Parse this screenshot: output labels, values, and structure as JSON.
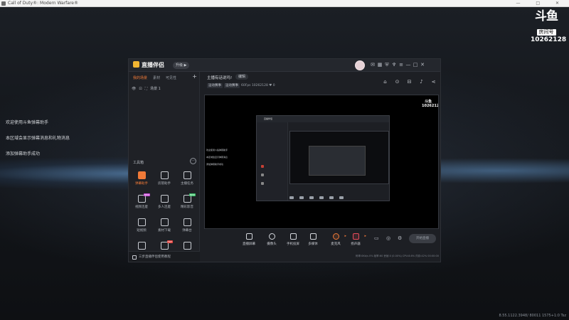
{
  "window": {
    "title": "Call of Duty®: Modern Warfare®"
  },
  "douyu": {
    "logo": "斗鱼",
    "room_label": "房间号",
    "room_number": "10262128"
  },
  "overlay_messages": [
    "欢迎使用斗鱼弹幕助手",
    "本区域会显示弹幕消息和礼物消息",
    "添加弹幕助手成功"
  ],
  "footer_stats": "8.55.1122.3948/ 80011 1575+1:0 Tsz",
  "app": {
    "brand": "直播伴侣",
    "brand_pill": "升级 ▶",
    "tabs": [
      "我的场景",
      "素材",
      "可见性"
    ],
    "scene_name": "场景 1",
    "room_title": "主播有话说吗!",
    "room_edit": "编辑",
    "room_tags": [
      "运动赛事",
      "运动赛事"
    ],
    "room_meta": "60Fps  10262128  ♥ 0",
    "toolbox_title": "工具箱",
    "tools": [
      {
        "label": "弹幕助手",
        "hot": true,
        "badge": ""
      },
      {
        "label": "房管助手",
        "hot": false,
        "badge": ""
      },
      {
        "label": "主播任务",
        "hot": false,
        "badge": ""
      },
      {
        "label": "视频连麽",
        "hot": false,
        "badge": "NEW"
      },
      {
        "label": "多人连麽",
        "hot": false,
        "badge": ""
      },
      {
        "label": "精彩影音",
        "hot": false,
        "badge": "NEW"
      },
      {
        "label": "短视频",
        "hot": false,
        "badge": ""
      },
      {
        "label": "素材下载",
        "hot": false,
        "badge": ""
      },
      {
        "label": "弹幕台",
        "hot": false,
        "badge": ""
      },
      {
        "label": "",
        "hot": false,
        "badge": ""
      },
      {
        "label": "",
        "hot": false,
        "badge": "HOT"
      },
      {
        "label": "",
        "hot": false,
        "badge": ""
      }
    ],
    "left_footer": "三步直播伴侣使用教程",
    "controls": [
      "直播屏幕",
      "摄像头",
      "手机投屏",
      "多媒体",
      "麦克风",
      "扬声器"
    ],
    "start_button": "开始直播",
    "statusbar": "码率:0Kb/s  0%  帧率:60  丢帧:0 (0.00%)  CPU:8.6%  内存:42%  00:00:00",
    "preview_messages": [
      "欢迎使用斗鱼弹幕助手",
      "本区域会显示弹幕消息",
      "添加弹幕助手成功"
    ],
    "nested_brand": "直播伴侣"
  }
}
